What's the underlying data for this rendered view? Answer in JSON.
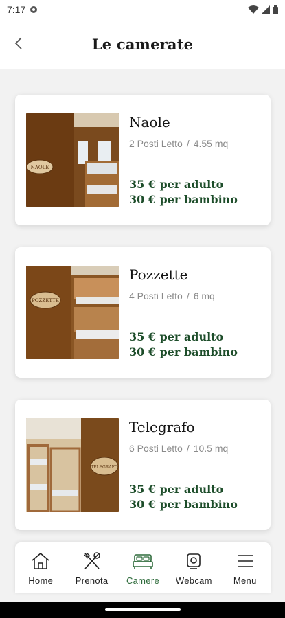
{
  "status_bar": {
    "time": "7:17"
  },
  "header": {
    "title": "Le camerate"
  },
  "rooms": [
    {
      "name": "Naole",
      "beds": "2 Posti Letto",
      "size": "4.55 mq",
      "price_adult": "35 € per adulto",
      "price_child": "30 € per bambino",
      "sign": "NAOLE"
    },
    {
      "name": "Pozzette",
      "beds": "4 Posti Letto",
      "size": "6 mq",
      "price_adult": "35 € per adulto",
      "price_child": "30 € per bambino",
      "sign": "POZZETTE"
    },
    {
      "name": "Telegrafo",
      "beds": "6 Posti Letto",
      "size": "10.5 mq",
      "price_adult": "35 € per adulto",
      "price_child": "30 € per bambino",
      "sign": "TELEGRAFO"
    }
  ],
  "meta_separator": "/",
  "nav": {
    "items": [
      {
        "label": "Home",
        "icon": "home-icon"
      },
      {
        "label": "Prenota",
        "icon": "utensils-icon"
      },
      {
        "label": "Camere",
        "icon": "bed-icon",
        "active": true
      },
      {
        "label": "Webcam",
        "icon": "webcam-icon"
      },
      {
        "label": "Menu",
        "icon": "hamburger-icon"
      }
    ]
  },
  "colors": {
    "accent": "#1d4d2a",
    "active_nav": "#2e6b3b",
    "background": "#f2f2f2"
  }
}
